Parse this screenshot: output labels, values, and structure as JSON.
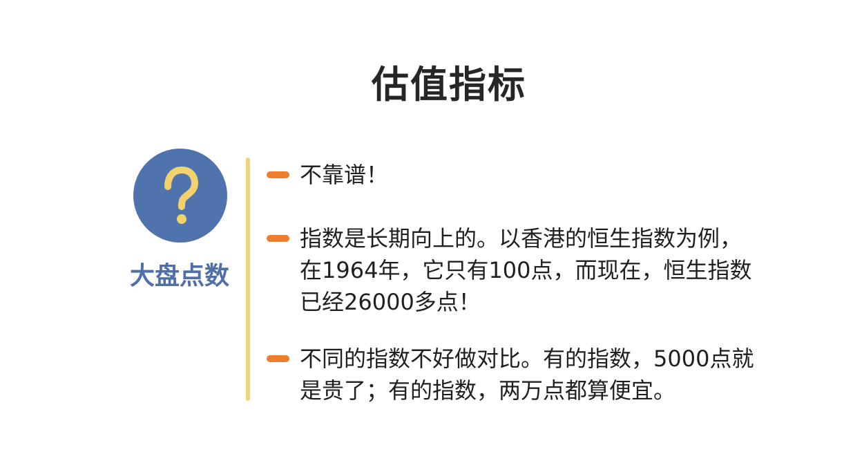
{
  "slide": {
    "title": "估值指标",
    "topic": {
      "icon": "question-mark-icon",
      "label": "大盘点数",
      "icon_color": "#4f73ad",
      "mark_color": "#f3d26d"
    },
    "bullets": [
      {
        "text": "不靠谱！"
      },
      {
        "text": "指数是长期向上的。以香港的恒生指数为例，\n在1964年，它只有100点，而现在，恒生指数\n已经26000多点！"
      },
      {
        "text": "不同的指数不好做对比。有的指数，5000点就\n是贵了；有的指数，两万点都算便宜。"
      }
    ],
    "colors": {
      "accent": "#ee7d2e",
      "divider": "#f1d37a",
      "label": "#4f6fa8"
    }
  }
}
